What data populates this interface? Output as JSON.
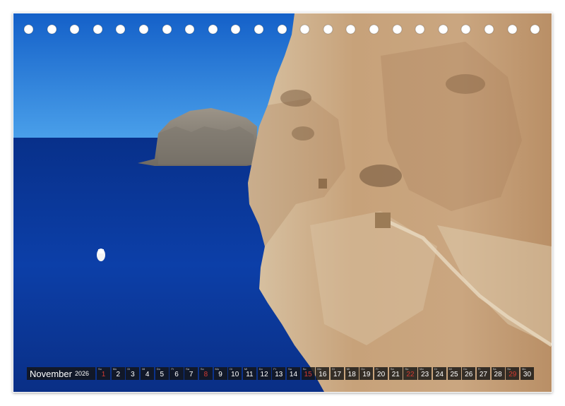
{
  "calendar": {
    "month": "November",
    "year": "2026",
    "days": [
      {
        "wd": "So",
        "d": "1",
        "sunday": true
      },
      {
        "wd": "Mo",
        "d": "2",
        "sunday": false
      },
      {
        "wd": "Di",
        "d": "3",
        "sunday": false
      },
      {
        "wd": "Mi",
        "d": "4",
        "sunday": false
      },
      {
        "wd": "Do",
        "d": "5",
        "sunday": false
      },
      {
        "wd": "Fr",
        "d": "6",
        "sunday": false
      },
      {
        "wd": "Sa",
        "d": "7",
        "sunday": false
      },
      {
        "wd": "So",
        "d": "8",
        "sunday": true
      },
      {
        "wd": "Mo",
        "d": "9",
        "sunday": false
      },
      {
        "wd": "Di",
        "d": "10",
        "sunday": false
      },
      {
        "wd": "Mi",
        "d": "11",
        "sunday": false
      },
      {
        "wd": "Do",
        "d": "12",
        "sunday": false
      },
      {
        "wd": "Fr",
        "d": "13",
        "sunday": false
      },
      {
        "wd": "Sa",
        "d": "14",
        "sunday": false
      },
      {
        "wd": "So",
        "d": "15",
        "sunday": true
      },
      {
        "wd": "Mo",
        "d": "16",
        "sunday": false
      },
      {
        "wd": "Di",
        "d": "17",
        "sunday": false
      },
      {
        "wd": "Mi",
        "d": "18",
        "sunday": false
      },
      {
        "wd": "Do",
        "d": "19",
        "sunday": false
      },
      {
        "wd": "Fr",
        "d": "20",
        "sunday": false
      },
      {
        "wd": "Sa",
        "d": "21",
        "sunday": false
      },
      {
        "wd": "So",
        "d": "22",
        "sunday": true
      },
      {
        "wd": "Mo",
        "d": "23",
        "sunday": false
      },
      {
        "wd": "Di",
        "d": "24",
        "sunday": false
      },
      {
        "wd": "Mi",
        "d": "25",
        "sunday": false
      },
      {
        "wd": "Do",
        "d": "26",
        "sunday": false
      },
      {
        "wd": "Fr",
        "d": "27",
        "sunday": false
      },
      {
        "wd": "Sa",
        "d": "28",
        "sunday": false
      },
      {
        "wd": "So",
        "d": "29",
        "sunday": true
      },
      {
        "wd": "Mo",
        "d": "30",
        "sunday": false
      }
    ]
  },
  "binding": {
    "hole_count": 23
  },
  "colors": {
    "sky": "#1f73d6",
    "sea": "#0a3a9a",
    "cliff": "#cdb08c",
    "sunday": "#d63a30",
    "strip": "#141414"
  }
}
